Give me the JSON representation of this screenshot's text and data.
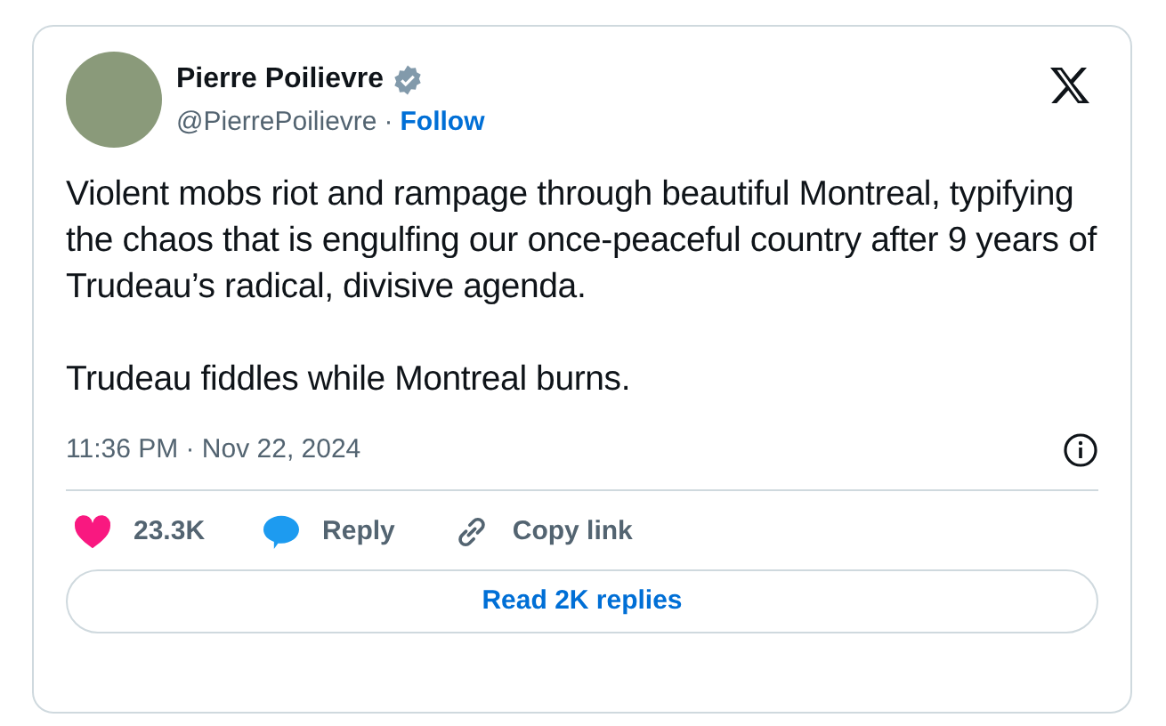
{
  "author": {
    "name": "Pierre Poilievre",
    "handle": "@PierrePoilievre",
    "separator": "·",
    "follow": "Follow"
  },
  "paragraphs": [
    "Violent mobs riot and rampage through beautiful Montreal, typifying the chaos that is engulfing our once-peaceful country after 9 years of Trudeau’s radical, divisive agenda.",
    "Trudeau fiddles while Montreal burns."
  ],
  "timestamp": "11:36 PM · Nov 22, 2024",
  "actions": [
    {
      "kind": "like",
      "label": "23.3K"
    },
    {
      "kind": "reply",
      "label": "Reply"
    },
    {
      "kind": "copy",
      "label": "Copy link"
    }
  ],
  "read_replies": "Read 2K replies"
}
